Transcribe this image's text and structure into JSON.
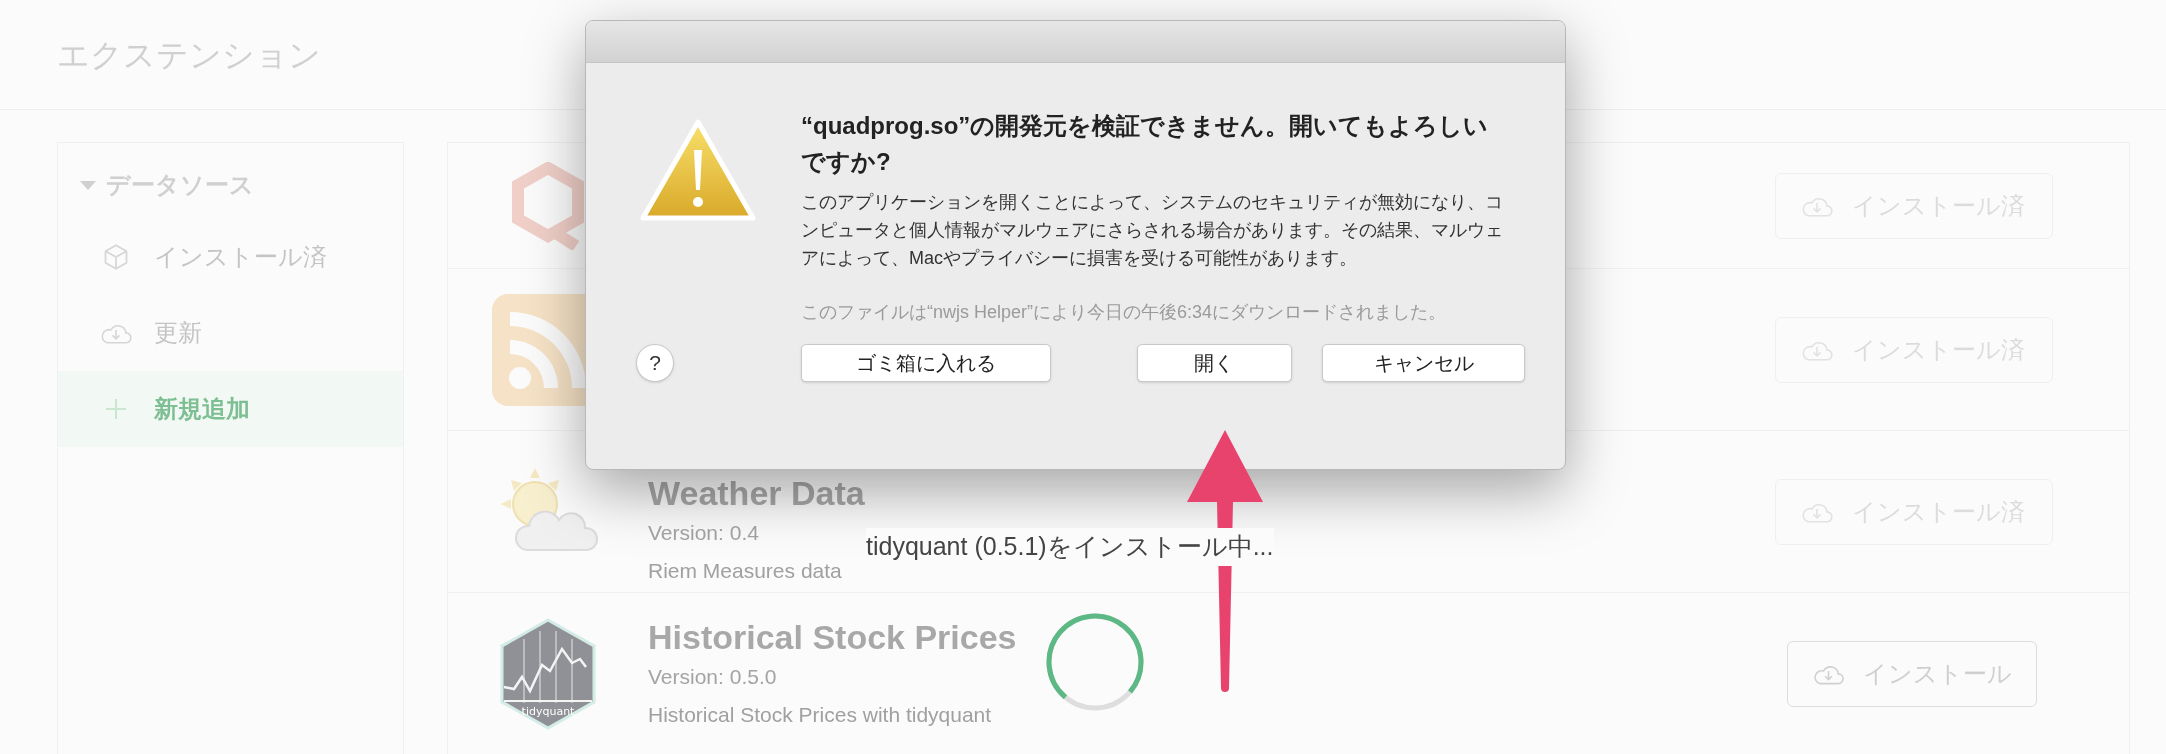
{
  "header": {
    "title": "エクステンション"
  },
  "sidebar": {
    "section": {
      "label": "データソース",
      "expanded": true
    },
    "items": [
      {
        "label": "インストール済",
        "selected": false
      },
      {
        "label": "更新",
        "selected": false
      },
      {
        "label": "新規追加",
        "selected": true
      }
    ]
  },
  "extensions": [
    {
      "button": {
        "label": "インストール済",
        "installed": true
      }
    },
    {
      "button": {
        "label": "インストール済",
        "installed": true
      }
    },
    {
      "title": "Weather Data",
      "version": "Version: 0.4",
      "description": "Riem Measures data",
      "button": {
        "label": "インストール済",
        "installed": true
      }
    },
    {
      "title": "Historical Stock Prices",
      "version": "Version: 0.5.0",
      "description": "Historical Stock Prices with tidyquant",
      "logo_text": "tidyquant",
      "button": {
        "label": "インストール",
        "installed": false
      }
    }
  ],
  "progress": {
    "message": "tidyquant (0.5.1)をインストール中...",
    "level": 0.75
  },
  "dialog": {
    "title": "“quadprog.so”の開発元を検証できません。開いてもよろしいですか?",
    "message": "このアプリケーションを開くことによって、システムのセキュリティが無効になり、コンピュータと個人情報がマルウェアにさらされる場合があります。その結果、マルウェアによって、Macやプライバシーに損害を受ける可能性があります。",
    "note": "このファイルは“nwjs Helper”により今日の午後6:34にダウンロードされました。",
    "help": "?",
    "buttons": [
      {
        "label": "ゴミ箱に入れる"
      },
      {
        "label": "開く"
      },
      {
        "label": "キャンセル"
      }
    ]
  }
}
